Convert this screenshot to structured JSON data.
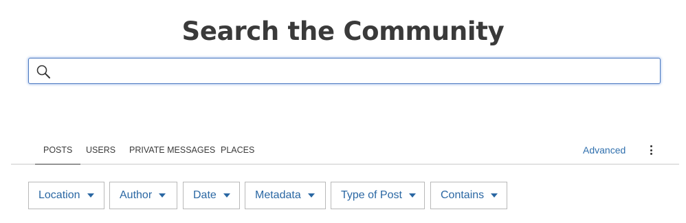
{
  "header": {
    "title": "Search the Community"
  },
  "search": {
    "value": "",
    "placeholder": ""
  },
  "tabs": [
    {
      "label": "POSTS",
      "active": true
    },
    {
      "label": "USERS",
      "active": false
    },
    {
      "label": "PRIVATE MESSAGES",
      "active": false
    },
    {
      "label": "PLACES",
      "active": false
    }
  ],
  "advanced_label": "Advanced",
  "filters": [
    {
      "label": "Location"
    },
    {
      "label": "Author"
    },
    {
      "label": "Date"
    },
    {
      "label": "Metadata"
    },
    {
      "label": "Type of Post"
    },
    {
      "label": "Contains"
    }
  ],
  "colors": {
    "link": "#2f6fad",
    "filter_text": "#2a67a3",
    "focus_border": "#4a78c0"
  },
  "icons": {
    "search": "search-icon",
    "more": "more-vertical-icon",
    "caret": "caret-down-icon"
  }
}
